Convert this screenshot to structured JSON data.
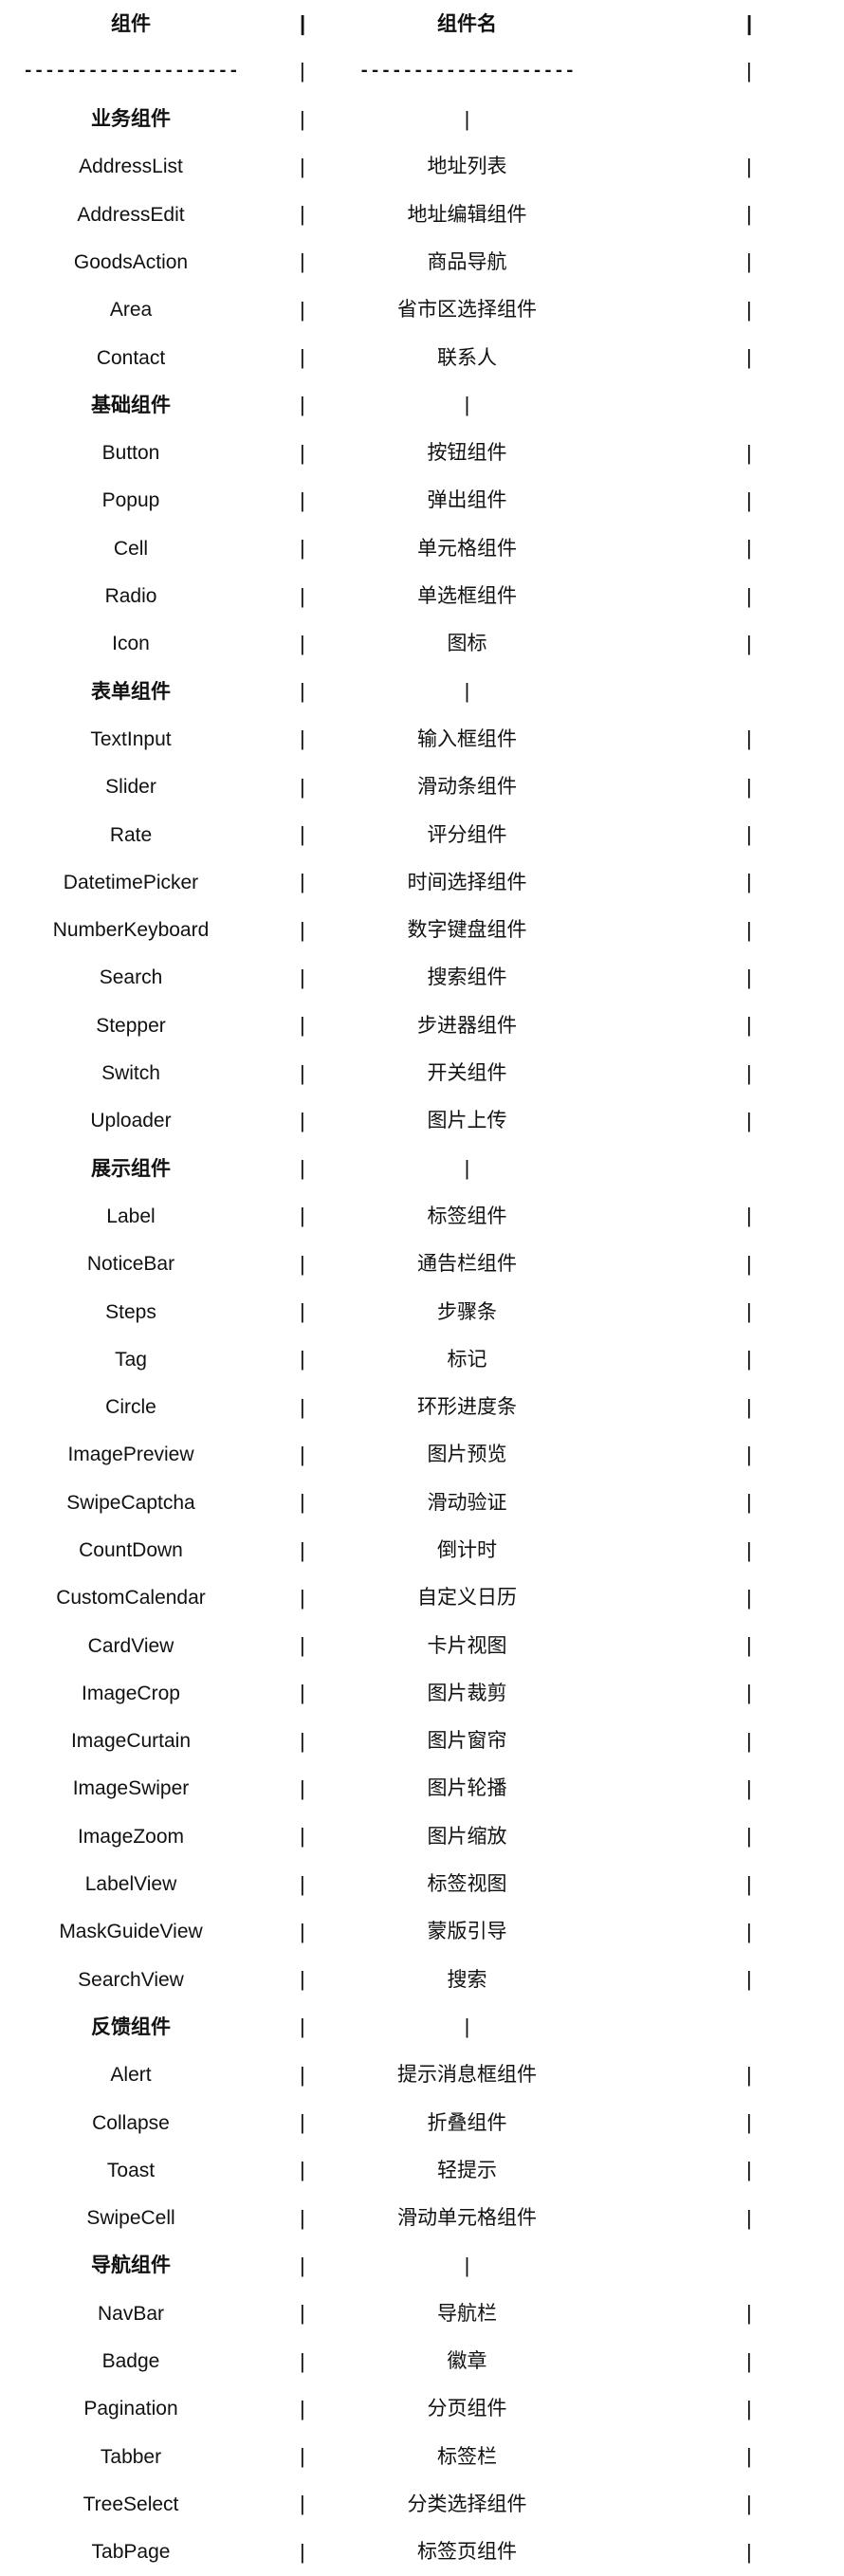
{
  "table": {
    "columns": [
      "组件",
      "组件名"
    ],
    "separator": "--------------------",
    "pipe": "|",
    "rows": [
      {
        "name": "业务组件",
        "desc": "",
        "group": true
      },
      {
        "name": "AddressList",
        "desc": "地址列表",
        "group": false
      },
      {
        "name": "AddressEdit",
        "desc": "地址编辑组件",
        "group": false
      },
      {
        "name": "GoodsAction",
        "desc": "商品导航",
        "group": false
      },
      {
        "name": "Area",
        "desc": "省市区选择组件",
        "group": false
      },
      {
        "name": "Contact",
        "desc": "联系人",
        "group": false
      },
      {
        "name": "基础组件",
        "desc": "",
        "group": true
      },
      {
        "name": "Button",
        "desc": "按钮组件",
        "group": false
      },
      {
        "name": "Popup",
        "desc": "弹出组件",
        "group": false
      },
      {
        "name": "Cell",
        "desc": "单元格组件",
        "group": false
      },
      {
        "name": "Radio",
        "desc": "单选框组件",
        "group": false
      },
      {
        "name": "Icon",
        "desc": "图标",
        "group": false
      },
      {
        "name": "表单组件",
        "desc": "",
        "group": true
      },
      {
        "name": "TextInput",
        "desc": "输入框组件",
        "group": false
      },
      {
        "name": "Slider",
        "desc": "滑动条组件",
        "group": false
      },
      {
        "name": "Rate",
        "desc": "评分组件",
        "group": false
      },
      {
        "name": "DatetimePicker",
        "desc": "时间选择组件",
        "group": false
      },
      {
        "name": "NumberKeyboard",
        "desc": "数字键盘组件",
        "group": false
      },
      {
        "name": "Search",
        "desc": "搜索组件",
        "group": false
      },
      {
        "name": "Stepper",
        "desc": "步进器组件",
        "group": false
      },
      {
        "name": "Switch",
        "desc": "开关组件",
        "group": false
      },
      {
        "name": "Uploader",
        "desc": "图片上传",
        "group": false
      },
      {
        "name": "展示组件",
        "desc": "",
        "group": true
      },
      {
        "name": "Label",
        "desc": "标签组件",
        "group": false
      },
      {
        "name": "NoticeBar",
        "desc": "通告栏组件",
        "group": false
      },
      {
        "name": "Steps",
        "desc": "步骤条",
        "group": false
      },
      {
        "name": "Tag",
        "desc": "标记",
        "group": false
      },
      {
        "name": "Circle",
        "desc": "环形进度条",
        "group": false
      },
      {
        "name": "ImagePreview",
        "desc": "图片预览",
        "group": false
      },
      {
        "name": "SwipeCaptcha",
        "desc": "滑动验证",
        "group": false
      },
      {
        "name": "CountDown",
        "desc": "倒计时",
        "group": false
      },
      {
        "name": "CustomCalendar",
        "desc": "自定义日历",
        "group": false
      },
      {
        "name": "CardView",
        "desc": "卡片视图",
        "group": false
      },
      {
        "name": "ImageCrop",
        "desc": "图片裁剪",
        "group": false
      },
      {
        "name": "ImageCurtain",
        "desc": "图片窗帘",
        "group": false
      },
      {
        "name": "ImageSwiper",
        "desc": "图片轮播",
        "group": false
      },
      {
        "name": "ImageZoom",
        "desc": "图片缩放",
        "group": false
      },
      {
        "name": "LabelView",
        "desc": "标签视图",
        "group": false
      },
      {
        "name": "MaskGuideView",
        "desc": "蒙版引导",
        "group": false
      },
      {
        "name": "SearchView",
        "desc": "搜索",
        "group": false
      },
      {
        "name": "反馈组件",
        "desc": "",
        "group": true
      },
      {
        "name": "Alert",
        "desc": "提示消息框组件",
        "group": false
      },
      {
        "name": "Collapse",
        "desc": "折叠组件",
        "group": false
      },
      {
        "name": "Toast",
        "desc": "轻提示",
        "group": false
      },
      {
        "name": "SwipeCell",
        "desc": "滑动单元格组件",
        "group": false
      },
      {
        "name": "导航组件",
        "desc": "",
        "group": true
      },
      {
        "name": "NavBar",
        "desc": "导航栏",
        "group": false
      },
      {
        "name": "Badge",
        "desc": "徽章",
        "group": false
      },
      {
        "name": "Pagination",
        "desc": "分页组件",
        "group": false
      },
      {
        "name": "Tabber",
        "desc": "标签栏",
        "group": false
      },
      {
        "name": "TreeSelect",
        "desc": "分类选择组件",
        "group": false
      },
      {
        "name": "TabPage",
        "desc": "标签页组件",
        "group": false
      }
    ]
  }
}
